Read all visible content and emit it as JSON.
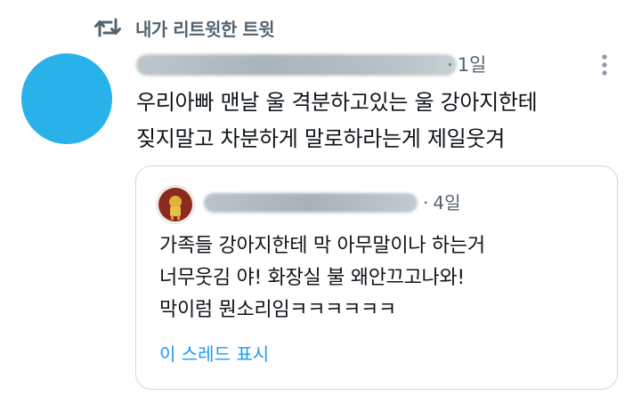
{
  "retweet_header": {
    "icon": "retweet-icon",
    "label": "내가 리트윗한 트윗"
  },
  "main_tweet": {
    "avatar_color": "#29b1ea",
    "time_separator": "·",
    "time": "1일",
    "more_icon": "more-vertical-icon",
    "text_lines": [
      "우리아빠 맨날 울 격분하고있는 울 강아지한테",
      "짖지말고 차분하게 말로하라는게 제일웃겨"
    ]
  },
  "quoted_tweet": {
    "time_separator": "·",
    "time": "4일",
    "text_lines": [
      "가족들 강아지한테 막 아무말이나 하는거",
      "너무웃김 야! 화장실 불 왜안끄고나와!",
      "막이럼 뭔소리임ㅋㅋㅋㅋㅋㅋ"
    ],
    "show_thread_label": "이 스레드 표시"
  },
  "colors": {
    "secondary_text": "#536471",
    "link": "#1d9bf0",
    "border": "#cfd9de"
  }
}
